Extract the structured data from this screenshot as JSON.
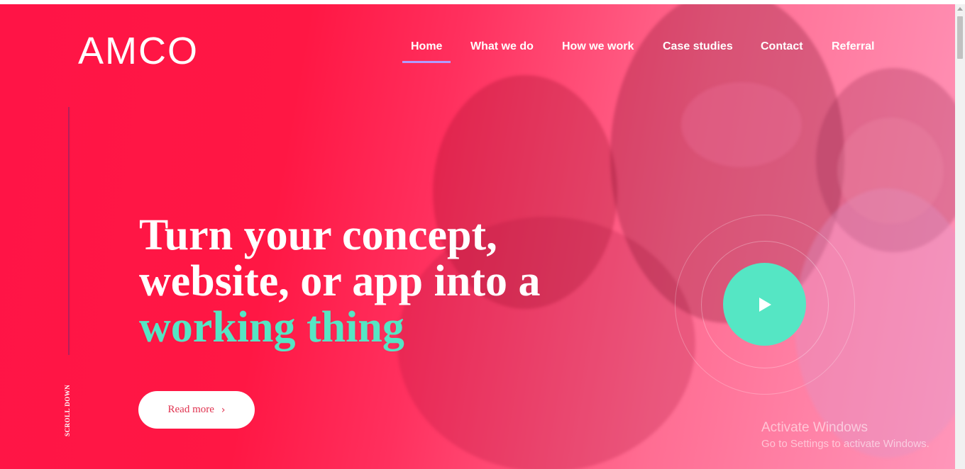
{
  "brand": {
    "logo": "AMCO"
  },
  "nav": {
    "items": [
      {
        "label": "Home",
        "active": true
      },
      {
        "label": "What we do",
        "active": false
      },
      {
        "label": "How we work",
        "active": false
      },
      {
        "label": "Case studies",
        "active": false
      },
      {
        "label": "Contact",
        "active": false
      },
      {
        "label": "Referral",
        "active": false
      }
    ]
  },
  "hero": {
    "headline_line1": "Turn your concept,",
    "headline_line2": "website, or app into a",
    "headline_accent": "working thing",
    "cta_label": "Read more",
    "scroll_label": "SCROLL DOWN",
    "play_icon": "play-icon"
  },
  "watermark": {
    "title": "Activate Windows",
    "subtitle": "Go to Settings to activate Windows."
  },
  "colors": {
    "primary": "#ff1744",
    "accent": "#55e6c4",
    "nav_underline": "#b19cff",
    "button_text": "#e0324f"
  }
}
